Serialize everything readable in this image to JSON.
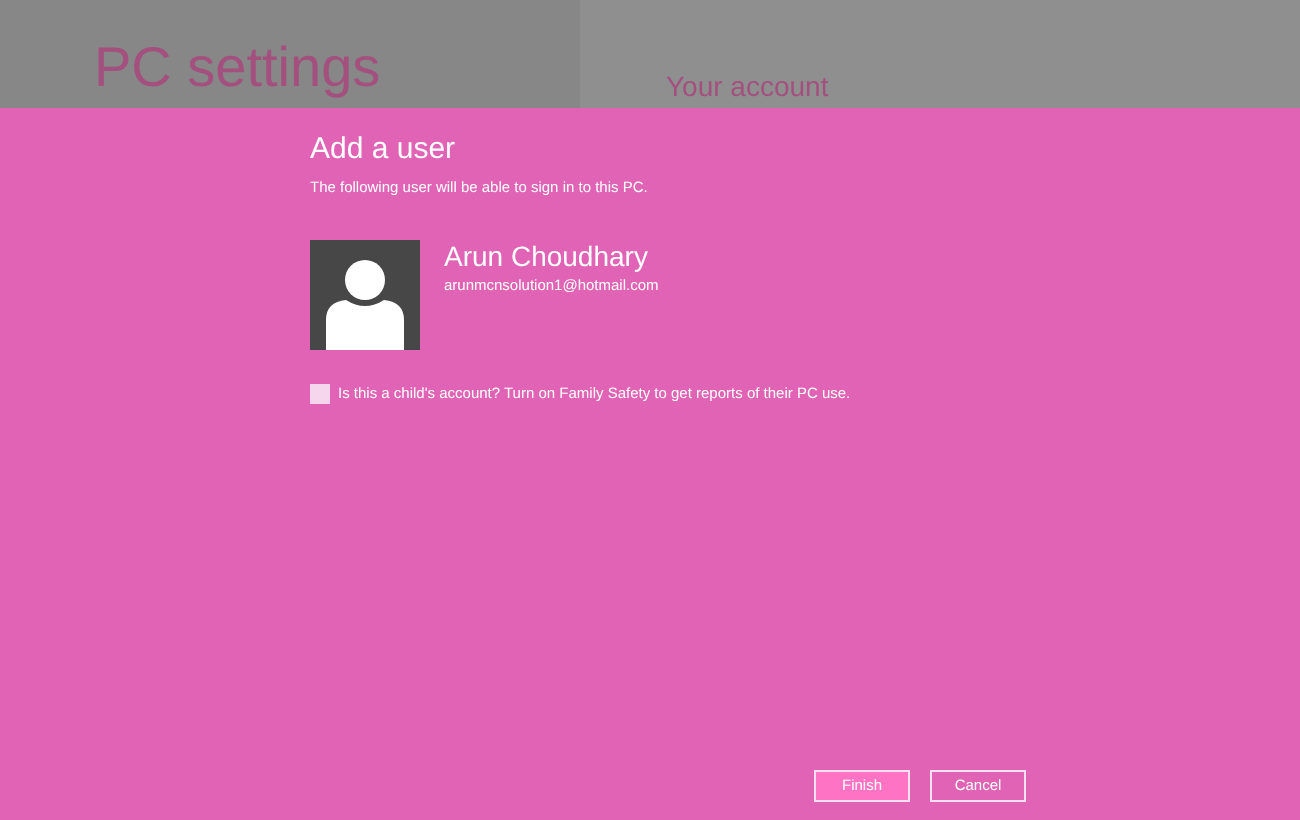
{
  "background": {
    "title": "PC settings",
    "section": "Your account"
  },
  "dialog": {
    "title": "Add a user",
    "subtitle": "The following user will be able to sign in to this PC.",
    "user": {
      "name": "Arun Choudhary",
      "email": "arunmcnsolution1@hotmail.com"
    },
    "child_account": {
      "label": "Is this a child's account? Turn on Family Safety to get reports of their PC use.",
      "checked": false
    },
    "buttons": [
      {
        "label": "Finish",
        "kind": "primary"
      },
      {
        "label": "Cancel",
        "kind": "secondary"
      }
    ]
  }
}
